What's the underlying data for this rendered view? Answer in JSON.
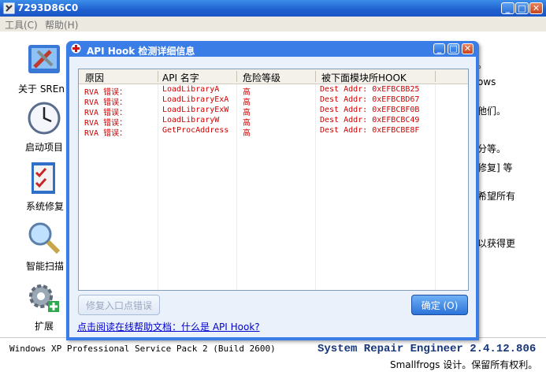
{
  "window": {
    "title": "7293D86C0",
    "minimize": "_",
    "maximize": "□",
    "close": "✕"
  },
  "menu": {
    "tools": "工具(C)",
    "help": "帮助(H)"
  },
  "sidebar": [
    {
      "label": "关于 SREn",
      "icon": "tools-icon"
    },
    {
      "label": "启动项目",
      "icon": "clock-icon"
    },
    {
      "label": "系统修复",
      "icon": "checklist-icon"
    },
    {
      "label": "智能扫描",
      "icon": "magnifier-icon"
    },
    {
      "label": "扩展",
      "icon": "gear-plus-icon"
    }
  ],
  "background_text": [
    "。",
    "ows",
    "他们。",
    "分等。",
    "修复] 等",
    "希望所有",
    "以获得更"
  ],
  "dialog": {
    "title": "API Hook 检测详细信息",
    "columns": [
      "原因",
      "API 名字",
      "危险等级",
      "被下面模块所HOOK"
    ],
    "rows": [
      [
        "RVA  错误：",
        "LoadLibraryA",
        "高",
        "Dest Addr: 0xEFBCBB25"
      ],
      [
        "RVA  错误：",
        "LoadLibraryExA",
        "高",
        "Dest Addr: 0xEFBCBD67"
      ],
      [
        "RVA  错误：",
        "LoadLibraryExW",
        "高",
        "Dest Addr: 0xEFBCBF0B"
      ],
      [
        "RVA  错误：",
        "LoadLibraryW",
        "高",
        "Dest Addr: 0xEFBCBC49"
      ],
      [
        "RVA  错误：",
        "GetProcAddress",
        "高",
        "Dest Addr: 0xEFBCBE8F"
      ]
    ],
    "fix_button": "修复入口点错误",
    "ok_button": "确定 (O)",
    "help_link": "点击阅读在线帮助文档：什么是 API Hook?"
  },
  "status": {
    "os": "Windows XP Professional Service Pack 2 (Build 2600)",
    "brand": "System Repair Engineer 2.4.12.806",
    "copyright": "Smallfrogs 设计。保留所有权利。"
  },
  "colors": {
    "titlebar": "#1f5fd0",
    "error_text": "#d10000",
    "link": "#0000d0"
  }
}
